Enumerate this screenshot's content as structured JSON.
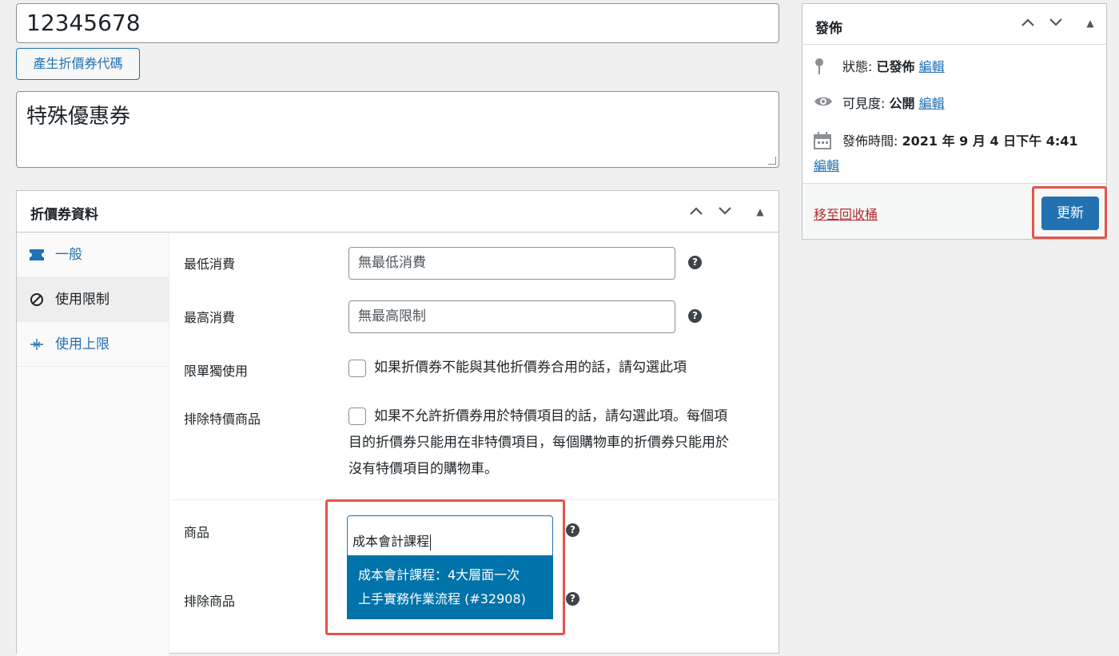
{
  "title": {
    "value": "12345678"
  },
  "generate_button": {
    "label": "產生折價券代碼"
  },
  "excerpt": {
    "value": "特殊優惠券"
  },
  "coupon_box": {
    "title": "折價券資料",
    "tabs": [
      {
        "label": "一般",
        "icon": "ticket-icon"
      },
      {
        "label": "使用限制",
        "icon": "block-icon"
      },
      {
        "label": "使用上限",
        "icon": "limit-icon"
      }
    ],
    "fields": {
      "min_spend": {
        "label": "最低消費",
        "placeholder": "無最低消費"
      },
      "max_spend": {
        "label": "最高消費",
        "placeholder": "無最高限制"
      },
      "individual_use": {
        "label": "限單獨使用",
        "text": "如果折價券不能與其他折價券合用的話，請勾選此項"
      },
      "exclude_sale": {
        "label": "排除特價商品",
        "text_line1": "如果不允許折價券用於特價項目的話，請勾選此項。每個項",
        "text_line2": "目的折價券只能用在非特價項目，每個購物車的折價券只能用於",
        "text_line3": "沒有特價項目的購物車。"
      },
      "products": {
        "label": "商品",
        "value": "成本會計課程"
      },
      "exclude_products": {
        "label": "排除商品"
      }
    },
    "dropdown": {
      "line1": "成本會計課程：4大層面一次",
      "line2": "上手實務作業流程 (#32908)"
    }
  },
  "publish_box": {
    "title": "發佈",
    "status_label": "狀態:",
    "status_value": "已發佈",
    "visibility_label": "可見度:",
    "visibility_value": "公開",
    "date_label": "發佈時間:",
    "date_value": "2021 年 9 月 4 日下午 4:41",
    "edit_link": "編輯",
    "trash_link": "移至回收桶",
    "update_button": "更新"
  },
  "colors": {
    "accent": "#2271b1",
    "highlight": "#e0564a",
    "dropdown": "#0073aa",
    "danger": "#b32d2e"
  }
}
